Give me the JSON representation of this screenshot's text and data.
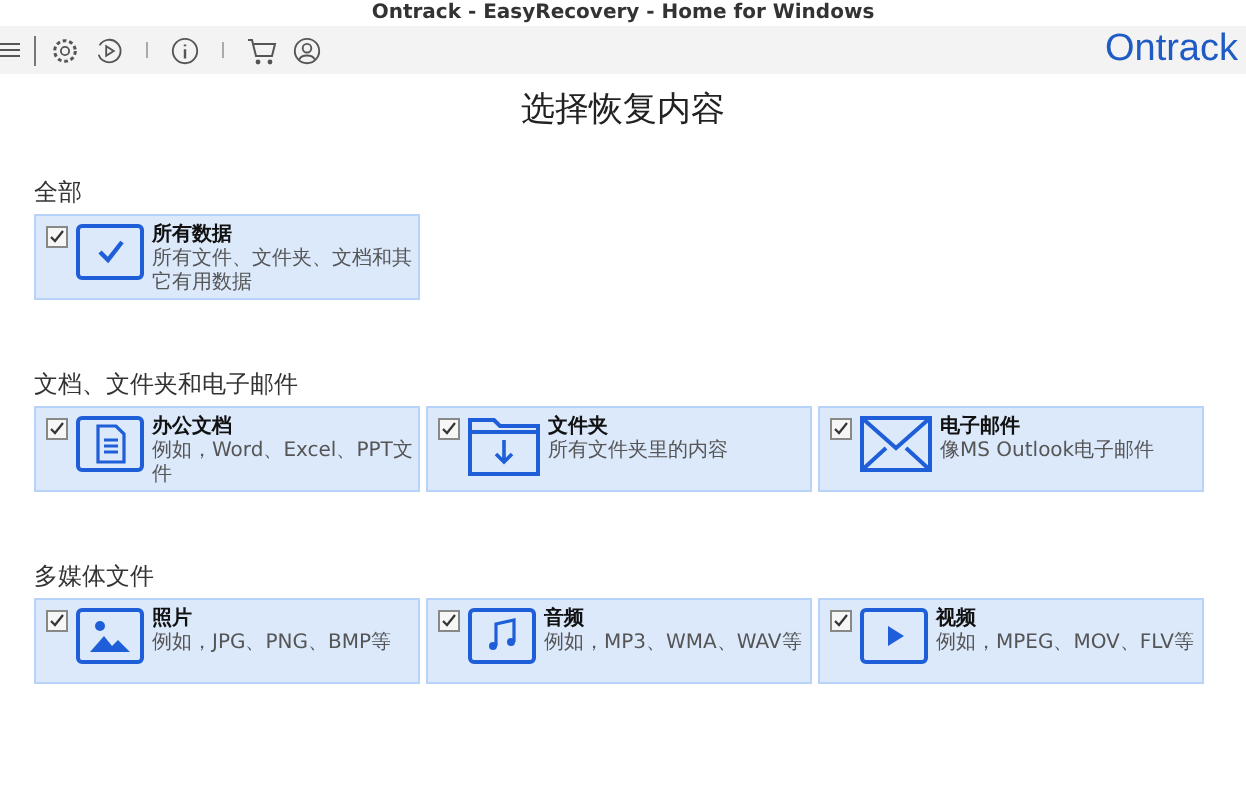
{
  "window": {
    "title": "Ontrack - EasyRecovery - Home for Windows"
  },
  "toolbar": {
    "brand": "Ontrack"
  },
  "heading": "选择恢复内容",
  "sections": [
    {
      "title": "全部",
      "items": [
        {
          "kind": "all",
          "title": "所有数据",
          "description": "所有文件、文件夹、文档和其它有用数据",
          "checked": true
        }
      ]
    },
    {
      "title": "文档、文件夹和电子邮件",
      "items": [
        {
          "kind": "document",
          "title": "办公文档",
          "description": "例如，Word、Excel、PPT文件",
          "checked": true
        },
        {
          "kind": "folder",
          "title": "文件夹",
          "description": "所有文件夹里的内容",
          "checked": true
        },
        {
          "kind": "email",
          "title": "电子邮件",
          "description": "像MS Outlook电子邮件",
          "checked": true
        }
      ]
    },
    {
      "title": "多媒体文件",
      "items": [
        {
          "kind": "photo",
          "title": "照片",
          "description": "例如，JPG、PNG、BMP等",
          "checked": true
        },
        {
          "kind": "audio",
          "title": "音频",
          "description": "例如，MP3、WMA、WAV等",
          "checked": true
        },
        {
          "kind": "video",
          "title": "视频",
          "description": "例如，MPEG、MOV、FLV等",
          "checked": true
        }
      ]
    }
  ]
}
